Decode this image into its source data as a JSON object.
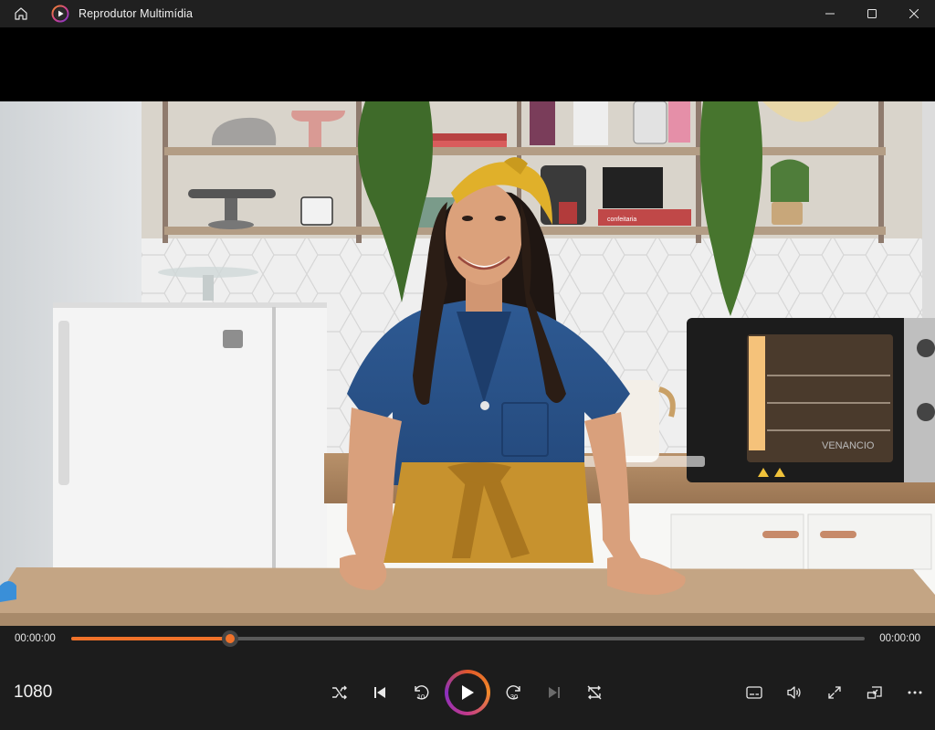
{
  "window": {
    "title": "Reprodutor Multimídia"
  },
  "player": {
    "current_time": "00:00:00",
    "total_time": "00:00:00",
    "progress": 0.2,
    "quality": "1080",
    "accent": "#f0722a"
  },
  "video": {
    "oven_brand": "VENANCIO",
    "book_label": "confeitaria"
  },
  "icons": {
    "home": "home-icon",
    "app": "media-player-logo-icon",
    "minimize": "minimize-icon",
    "maximize": "maximize-icon",
    "close": "close-icon",
    "shuffle": "shuffle-icon",
    "previous": "previous-icon",
    "rewind": "rewind-10-icon",
    "play": "play-icon",
    "forward": "forward-30-icon",
    "next": "next-icon",
    "repeat": "repeat-off-icon",
    "captions": "captions-icon",
    "volume": "volume-icon",
    "fullscreen": "fullscreen-icon",
    "miniplayer": "miniplayer-icon",
    "more": "more-icon"
  }
}
